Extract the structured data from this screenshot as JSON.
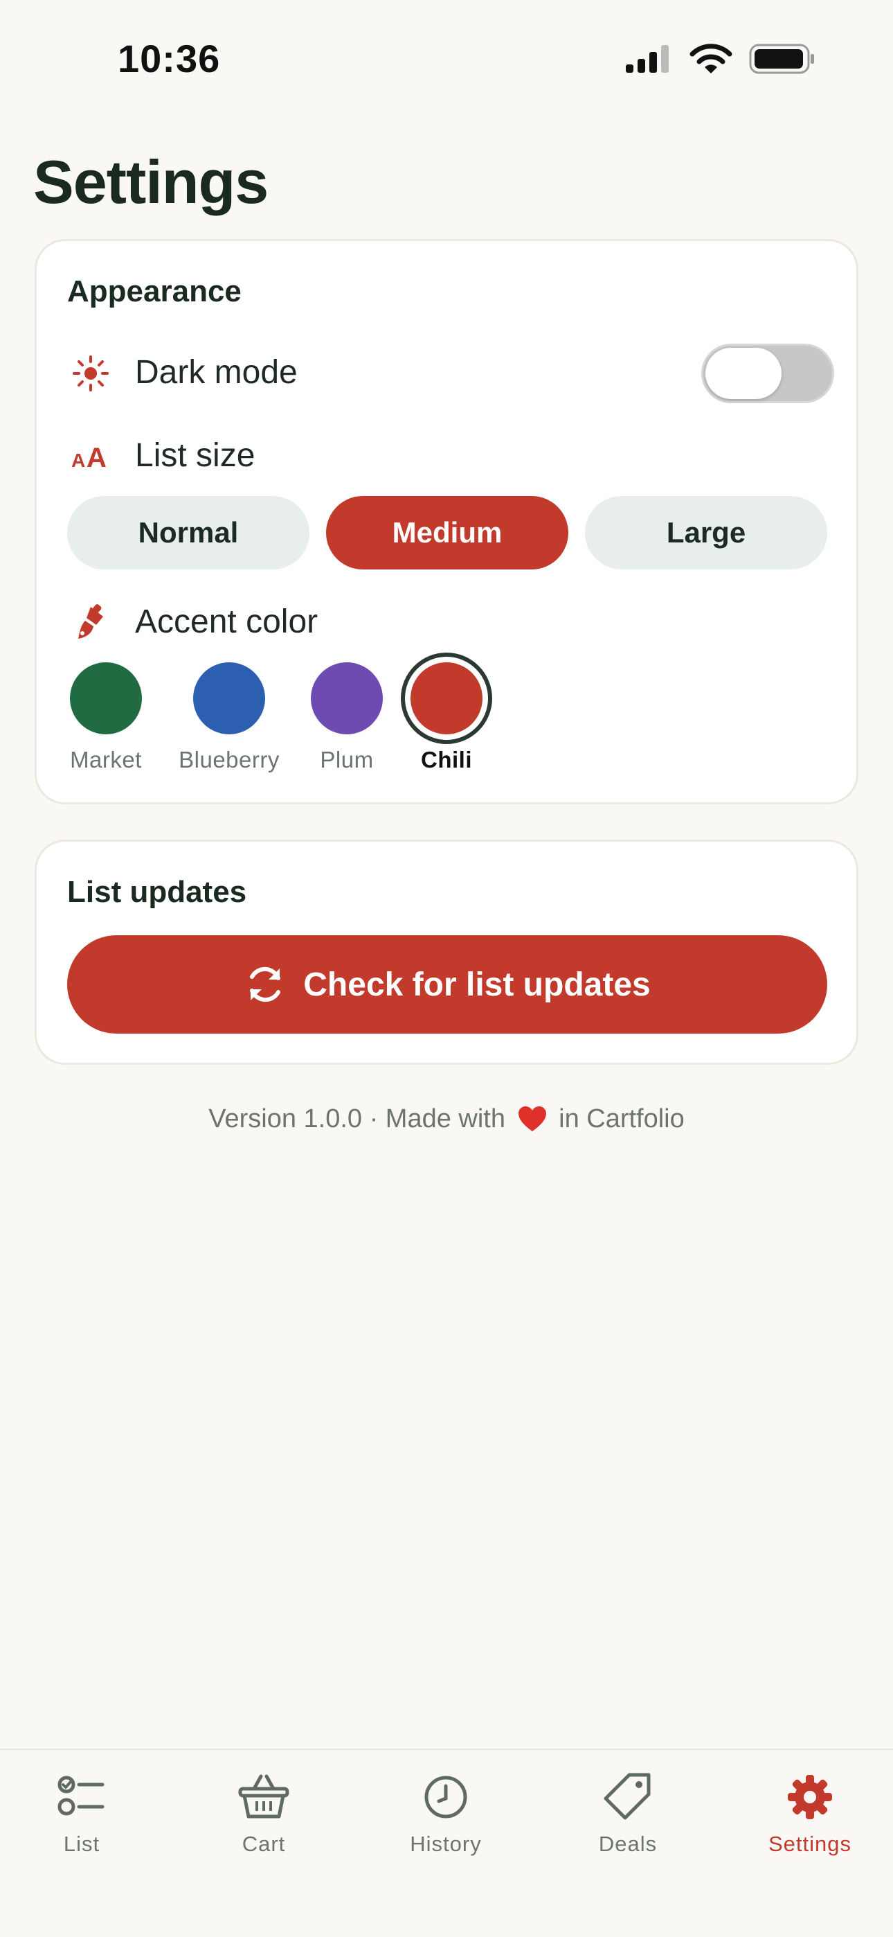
{
  "status_bar": {
    "time": "10:36"
  },
  "page": {
    "title": "Settings"
  },
  "appearance": {
    "heading": "Appearance",
    "dark_mode_label": "Dark mode",
    "dark_mode_on": false,
    "list_size_label": "List size",
    "sizes": [
      "Normal",
      "Medium",
      "Large"
    ],
    "selected_size": "Medium",
    "accent_label": "Accent color",
    "accents": [
      {
        "name": "Market",
        "color": "#216b43"
      },
      {
        "name": "Blueberry",
        "color": "#2d5fb0"
      },
      {
        "name": "Plum",
        "color": "#6e4bb0"
      },
      {
        "name": "Chili",
        "color": "#c13a2c"
      }
    ],
    "selected_accent": "Chili"
  },
  "updates": {
    "heading": "List updates",
    "button_label": "Check for list updates"
  },
  "footer": {
    "version_prefix": "Version 1.0.0 · Made with",
    "version_suffix": "in Cartfolio"
  },
  "tabs": [
    {
      "label": "List",
      "icon": "checklist-icon"
    },
    {
      "label": "Cart",
      "icon": "basket-icon"
    },
    {
      "label": "History",
      "icon": "clock-icon"
    },
    {
      "label": "Deals",
      "icon": "tag-icon"
    },
    {
      "label": "Settings",
      "icon": "gear-icon"
    }
  ],
  "active_tab": "Settings",
  "colors": {
    "accent": "#c13a2c",
    "muted": "#6b7470",
    "icon_gray": "#5f6a64"
  }
}
